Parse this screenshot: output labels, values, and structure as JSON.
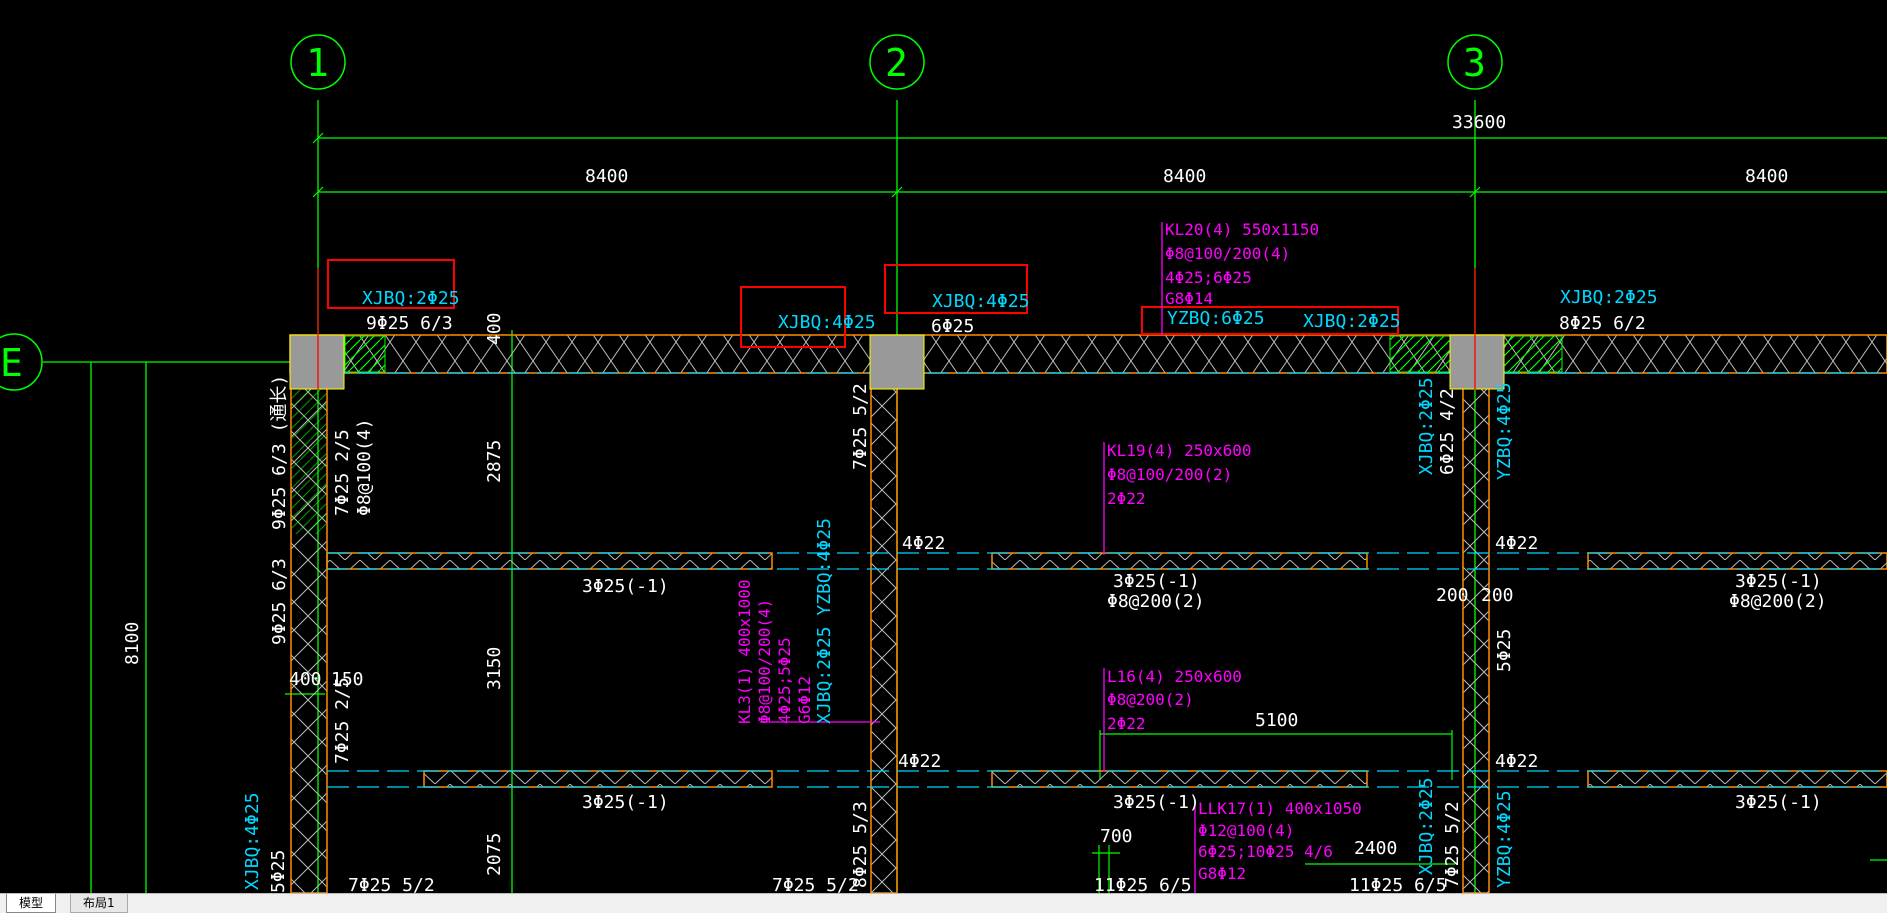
{
  "tabs": {
    "model": "模型",
    "layout1": "布局1"
  },
  "axes": {
    "axis_1": "1",
    "axis_2": "2",
    "axis_3": "3",
    "axis_e": "E"
  },
  "dimensions": {
    "total": "33600",
    "span_1": "8400",
    "span_2": "8400",
    "span_3": "8400",
    "d400_top": "400",
    "d2875": "2875",
    "d3150": "3150",
    "d2075": "2075",
    "d8100": "8100",
    "d400_left": "400",
    "d150": "150",
    "d200_a": "200",
    "d200_b": "200",
    "d5100": "5100",
    "d700": "700",
    "d2400": "2400"
  },
  "labels": {
    "xjbq_1": "XJBQ:2Φ25",
    "bot_1": "9Φ25 6/3",
    "xjbq_mid1": "XJBQ:4Φ25",
    "xjbq_2": "XJBQ:4Φ25",
    "bot_2": "6Φ25",
    "yzbq_top": "YZBQ:6Φ25",
    "xjbq_top_r": "XJBQ:2Φ25",
    "xjbq_3": "XJBQ:2Φ25",
    "bot_3": "8Φ25 6/2",
    "v_left_1": "9Φ25 6/3 (通长)",
    "v_left_2": "7Φ25 2/5",
    "v_left_3": "Φ8@100(4)",
    "v_left_4": "9Φ25 6/3",
    "v_left_5": "7Φ25 2/5",
    "v_left_6": "XJBQ:4Φ25",
    "v_left_7": "5Φ25",
    "v_col2_top": "7Φ25 5/2",
    "v_col2_bot": "8Φ25 5/3",
    "v_col3_a": "XJBQ:2Φ25",
    "v_col3_b": "6Φ25 4/2",
    "v_col3_c": "YZBQ:4Φ25",
    "v_col3_d": "5Φ25",
    "v_col3_e": "XJBQ:2Φ25",
    "v_col3_f": "7Φ25 5/2",
    "v_col3_g": "YZBQ:4Φ25",
    "b1_l": "3Φ25(-1)",
    "b1_m": "3Φ25(-1)",
    "b1_m2": "Φ8@200(2)",
    "b1_r": "3Φ25(-1)",
    "b1_r2": "Φ8@200(2)",
    "b2_l": "3Φ25(-1)",
    "b2_m": "3Φ25(-1)",
    "b2_r": "3Φ25(-1)",
    "k4a": "4Φ22",
    "k4b": "4Φ22",
    "k4c": "4Φ22",
    "k4d": "4Φ22",
    "bot_l": "7Φ25 5/2",
    "bot_m": "7Φ25 5/2",
    "bot_r1": "11Φ25 6/5",
    "bot_r2": "11Φ25 6/5",
    "v_kl3_1": "KL3(1) 400x1000",
    "v_kl3_2": "Φ8@100/200(4)",
    "v_kl3_3": "4Φ25;5Φ25",
    "v_kl3_4": "G6Φ12",
    "v_kl3_5": "XJBQ:2Φ25 YZBQ:4Φ25"
  },
  "beam_notes": {
    "kl20": [
      "KL20(4) 550x1150",
      "Φ8@100/200(4)",
      "4Φ25;6Φ25",
      "G8Φ14"
    ],
    "kl19": [
      "KL19(4) 250x600",
      "Φ8@100/200(2)",
      "2Φ22"
    ],
    "l16": [
      "L16(4) 250x600",
      "Φ8@200(2)",
      "2Φ22"
    ],
    "llk17": [
      "LLK17(1) 400x1050",
      "Φ12@100(4)",
      "6Φ25;10Φ25 4/6",
      "G8Φ12"
    ]
  },
  "colors": {
    "background": "#000000",
    "axis": "#00ff00",
    "dim_text": "#ffffff",
    "rebar_text": "#00d8ff",
    "beam_note": "#ff00ff",
    "beam_edge": "#ff8c00",
    "column_fill": "#999999",
    "highlight_box": "#ff0000"
  }
}
